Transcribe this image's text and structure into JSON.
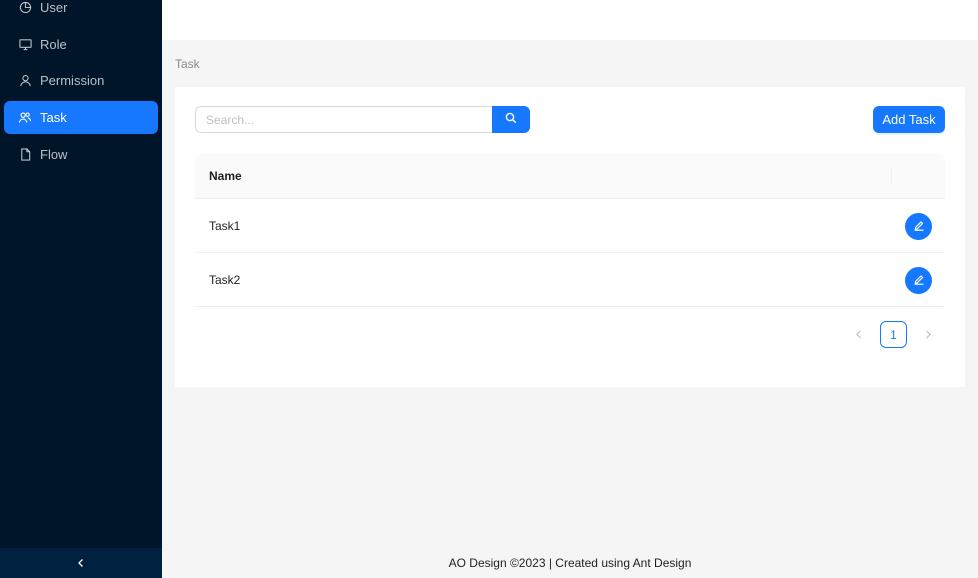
{
  "sidebar": {
    "items": [
      {
        "label": "User",
        "icon": "pie-chart-icon"
      },
      {
        "label": "Role",
        "icon": "desktop-icon"
      },
      {
        "label": "Permission",
        "icon": "user-icon"
      },
      {
        "label": "Task",
        "icon": "team-icon",
        "selected": true
      },
      {
        "label": "Flow",
        "icon": "file-icon"
      }
    ],
    "collapse_icon": "left-chevron-icon"
  },
  "breadcrumb": {
    "current": "Task"
  },
  "toolbar": {
    "search_placeholder": "Search...",
    "search_icon": "search-icon",
    "add_label": "Add Task"
  },
  "table": {
    "columns": [
      "Name",
      ""
    ],
    "rows": [
      {
        "name": "Task1",
        "action_icon": "edit-icon"
      },
      {
        "name": "Task2",
        "action_icon": "edit-icon"
      }
    ]
  },
  "pagination": {
    "current_page": "1"
  },
  "footer": {
    "text": "AO Design ©2023 | Created using Ant Design"
  },
  "colors": {
    "primary": "#1677ff",
    "sider": "#001529",
    "sider_trigger": "#002140"
  }
}
